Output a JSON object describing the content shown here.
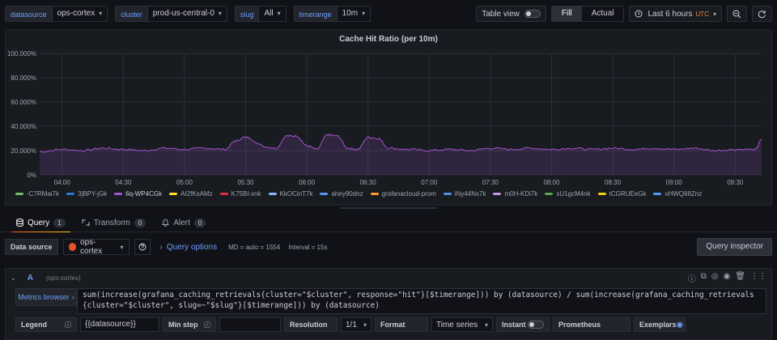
{
  "variables": [
    {
      "label": "datasource",
      "value": "ops-cortex"
    },
    {
      "label": "cluster",
      "value": "prod-us-central-0"
    },
    {
      "label": "slug",
      "value": "All"
    },
    {
      "label": "timerange",
      "value": "10m"
    }
  ],
  "toolbar": {
    "table_view_label": "Table view",
    "fill_label": "Fill",
    "actual_label": "Actual",
    "time_range_label": "Last 6 hours",
    "timezone_label": "UTC"
  },
  "panel": {
    "title": "Cache Hit Ratio (per 10m)"
  },
  "chart_data": {
    "type": "line",
    "ylim": [
      0,
      100
    ],
    "yticks": [
      "0%",
      "20.000%",
      "40.000%",
      "60.000%",
      "80.000%",
      "100.000%"
    ],
    "xticks": [
      "04:00",
      "04:30",
      "05:00",
      "05:30",
      "06:00",
      "06:30",
      "07:00",
      "07:30",
      "08:00",
      "08:30",
      "09:00",
      "09:30"
    ],
    "series_color": "#a352cc",
    "series_name": "6q-WP4CGk",
    "x": [
      "03:49",
      "04:00",
      "04:10",
      "04:20",
      "04:30",
      "04:40",
      "04:50",
      "05:00",
      "05:10",
      "05:20",
      "05:25",
      "05:30",
      "05:40",
      "05:45",
      "05:50",
      "05:55",
      "06:00",
      "06:05",
      "06:10",
      "06:15",
      "06:20",
      "06:25",
      "06:30",
      "06:35",
      "06:40",
      "06:50",
      "07:00",
      "07:10",
      "07:20",
      "07:30",
      "07:40",
      "07:50",
      "08:00",
      "08:10",
      "08:20",
      "08:30",
      "08:40",
      "08:50",
      "09:00",
      "09:10",
      "09:20",
      "09:30",
      "09:40",
      "09:43"
    ],
    "values": [
      19,
      21,
      20,
      22,
      21,
      20,
      22,
      21,
      22,
      21,
      28,
      31,
      23,
      22,
      32,
      32,
      24,
      21,
      33,
      32,
      22,
      21,
      31,
      30,
      22,
      21,
      20,
      21,
      20,
      22,
      21,
      22,
      21,
      22,
      21,
      22,
      21,
      22,
      21,
      22,
      20,
      21,
      21,
      29
    ]
  },
  "legend": [
    {
      "name": "-C7RMai7k",
      "color": "#73bf69"
    },
    {
      "name": "3jBPY-jGk",
      "color": "#3274d9"
    },
    {
      "name": "6q-WP4CGk",
      "color": "#a352cc"
    },
    {
      "name": "AI2fKsAMz",
      "color": "#fade2a"
    },
    {
      "name": "K75BI-xnk",
      "color": "#e02f44"
    },
    {
      "name": "KkOCinT7k",
      "color": "#8ab8ff"
    },
    {
      "name": "ahey90dnz",
      "color": "#5794f2"
    },
    {
      "name": "grafanacloud-prom",
      "color": "#ff9830"
    },
    {
      "name": "iNy44Nx7k",
      "color": "#4a90e2"
    },
    {
      "name": "m0H-KDi7k",
      "color": "#ca95e5"
    },
    {
      "name": "sU1gcM4nk",
      "color": "#56a64b"
    },
    {
      "name": "tCGRUEeGk",
      "color": "#f2cc0c"
    },
    {
      "name": "xHWQ88Znz",
      "color": "#5794f2"
    }
  ],
  "editor_tabs": [
    {
      "label": "Query",
      "count": "1"
    },
    {
      "label": "Transform",
      "count": "0"
    },
    {
      "label": "Alert",
      "count": "0"
    }
  ],
  "datasource_row": {
    "label": "Data source",
    "value": "ops-cortex",
    "query_options": "Query options",
    "md_text": "MD = auto = 1554",
    "interval_text": "Interval = 15s",
    "inspector": "Query inspector"
  },
  "query": {
    "letter": "A",
    "datasource": "(ops-cortex)",
    "metrics_browser": "Metrics browser",
    "expr_line1": "sum(increase(grafana_caching_retrievals{cluster=\"$cluster\", response=\"hit\"}[$timerange])) by (datasource) / sum(increase(grafana_caching_retrievals",
    "expr_line2": "{cluster=\"$cluster\", slug=~\"$slug\"}[$timerange])) by (datasource)",
    "legend_label": "Legend",
    "legend_value": "{{datasource}}",
    "minstep_label": "Min step",
    "minstep_value": "",
    "resolution_label": "Resolution",
    "resolution_value": "1/1",
    "format_label": "Format",
    "format_value": "Time series",
    "instant_label": "Instant",
    "prometheus_label": "Prometheus",
    "exemplars_label": "Exemplars"
  }
}
